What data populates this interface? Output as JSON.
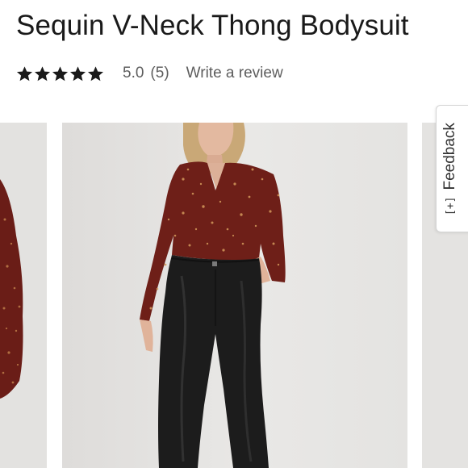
{
  "product": {
    "title": "Sequin V-Neck Thong Bodysuit"
  },
  "rating": {
    "stars": 5,
    "max_stars": 5,
    "value": "5.0",
    "count": "(5)",
    "write_review_label": "Write a review"
  },
  "feedback": {
    "label": "Feedback",
    "icon_text": "[+]",
    "icon": "plus-bracket-icon"
  },
  "carousel": {
    "images": [
      {
        "name": "previous-product-image"
      },
      {
        "name": "main-product-image"
      },
      {
        "name": "next-product-image"
      }
    ]
  },
  "colors": {
    "star": "#1a1a1a",
    "text_secondary": "#5d5d5d",
    "sequin": "#6e1f18",
    "pants": "#1c1c1c"
  }
}
